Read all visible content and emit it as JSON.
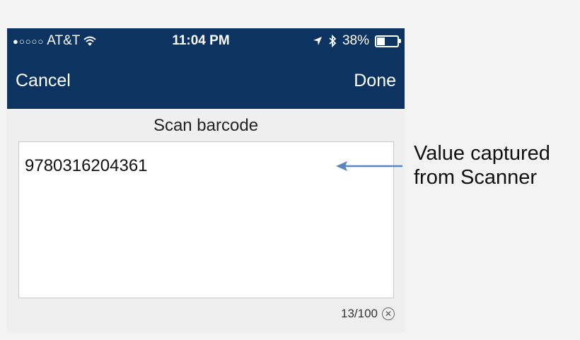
{
  "status_bar": {
    "signal_dots": "●○○○○",
    "carrier": "AT&T",
    "time": "11:04 PM",
    "battery_pct": "38%",
    "battery_level": 0.38
  },
  "nav": {
    "cancel_label": "Cancel",
    "done_label": "Done"
  },
  "form": {
    "title": "Scan barcode",
    "value": "9780316204361",
    "counter": "13/100"
  },
  "annotation": {
    "line1": "Value captured",
    "line2": "from Scanner"
  },
  "colors": {
    "nav_background": "#0d3360",
    "arrow": "#5b86bd"
  }
}
